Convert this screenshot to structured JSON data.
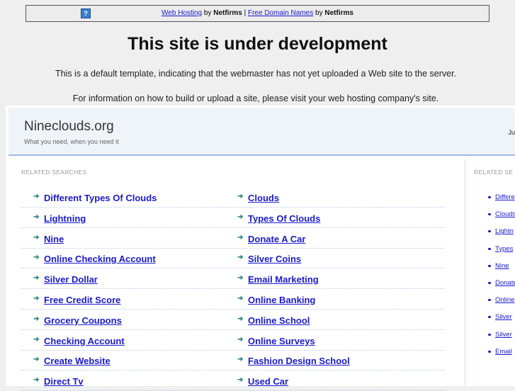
{
  "topbar": {
    "link1": "Web Hosting",
    "by1": "by",
    "brand1": "Netfirms",
    "sep": "|",
    "link2": "Free Domain Names",
    "by2": "by",
    "brand2": "Netfirms",
    "help_icon": "?"
  },
  "title": "This site is under development",
  "line1": "This is a default template, indicating that the webmaster has not yet uploaded a Web site to the server.",
  "line2": "For information on how to build or upload a site, please visit your web hosting company's site.",
  "site": {
    "name": "Nineclouds.org",
    "tagline": "What you need, when you need it",
    "right_text": "Ju"
  },
  "main": {
    "heading": "RELATED SEARCHES",
    "left": [
      "Different Types Of Clouds",
      "Lightning",
      "Nine",
      "Online Checking Account",
      "Silver Dollar",
      "Free Credit Score",
      "Grocery Coupons",
      "Checking Account",
      "Create Website",
      "Direct Tv"
    ],
    "right": [
      "Clouds",
      "Types Of Clouds",
      "Donate A Car",
      "Silver Coins",
      "Email Marketing",
      "Online Banking",
      "Online School",
      "Online Surveys",
      "Fashion Design School",
      "Used Car"
    ]
  },
  "sidebar": {
    "heading": "RELATED SE",
    "items": [
      "Differe",
      "Clouds",
      "Lightn",
      "Types",
      "Nine",
      "Donate",
      "Online",
      "Silver",
      "Silver",
      "Email"
    ]
  }
}
